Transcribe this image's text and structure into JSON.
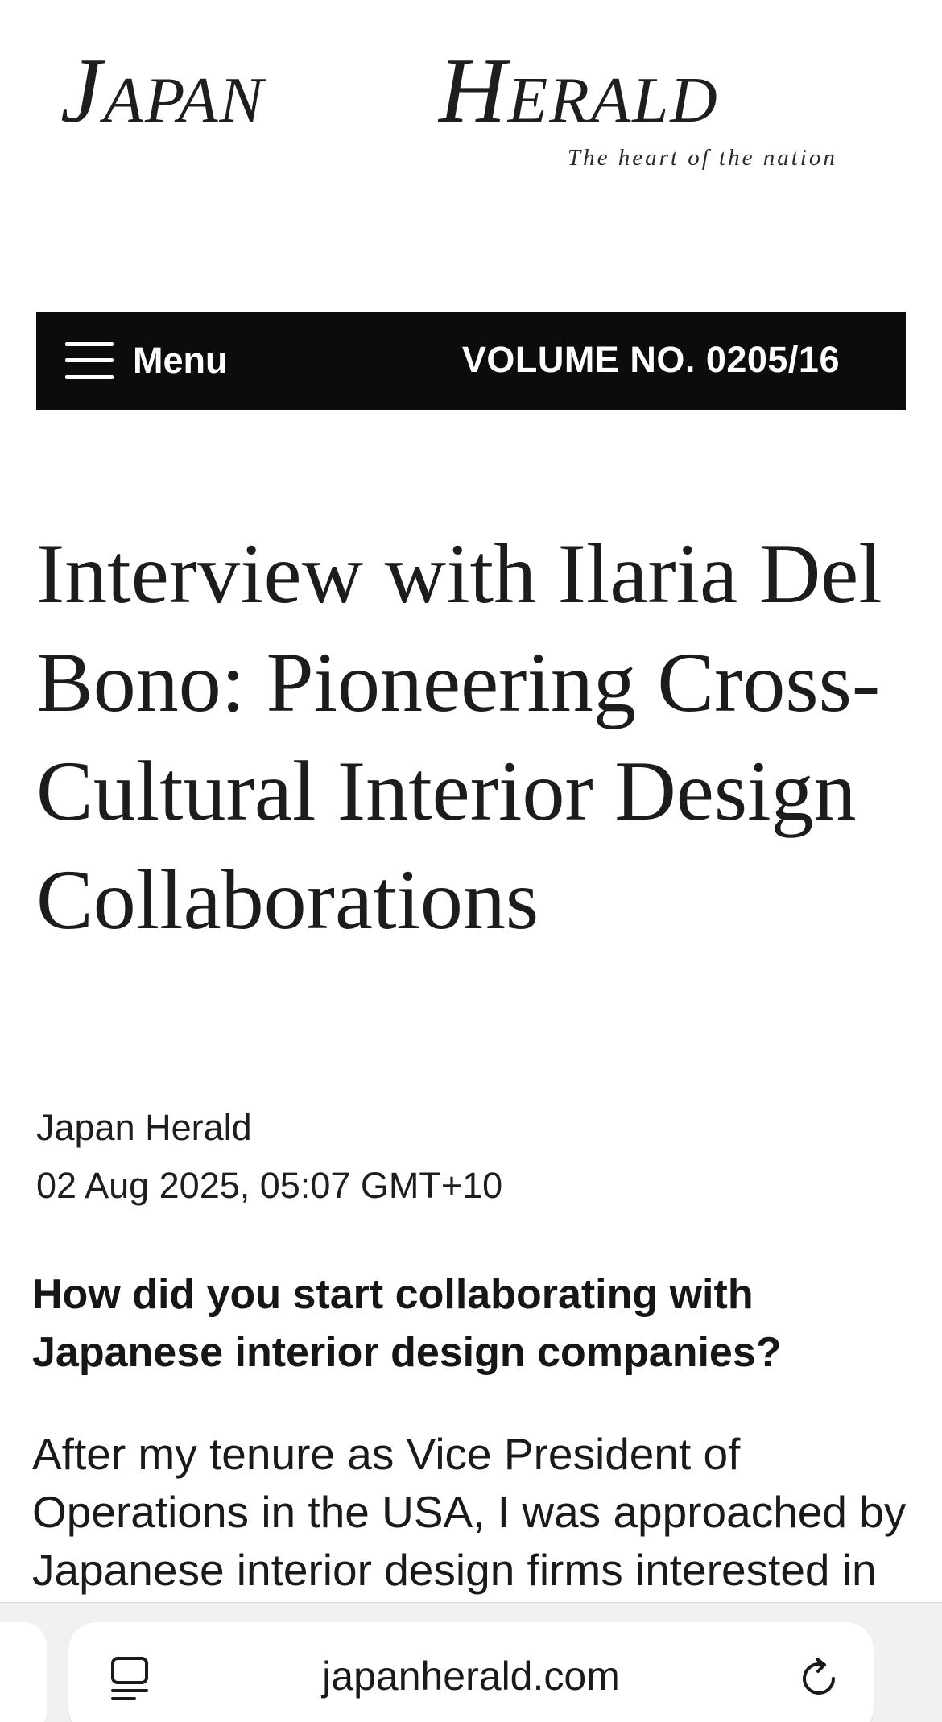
{
  "masthead": {
    "logo_word_1": "Japan",
    "logo_word_2": "Herald",
    "tagline": "The heart of the nation"
  },
  "navbar": {
    "menu_label": "Menu",
    "volume": "VOLUME NO. 0205/16",
    "menu_icon": "hamburger-icon"
  },
  "article": {
    "headline": "Interview with Ilaria Del Bono: Pioneering Cross-Cultural Interior Design Collaborations",
    "author": "Japan Herald",
    "date": "02 Aug 2025, 05:07 GMT+10",
    "question": "How did you start collaborating with Japanese interior design companies?",
    "answer": "After my tenure as Vice President of Operations in the USA, I was approached by Japanese interior design firms interested in"
  },
  "browser": {
    "url": "japanherald.com",
    "left_icon": "reader-mode-icon",
    "right_icon": "reload-icon"
  }
}
